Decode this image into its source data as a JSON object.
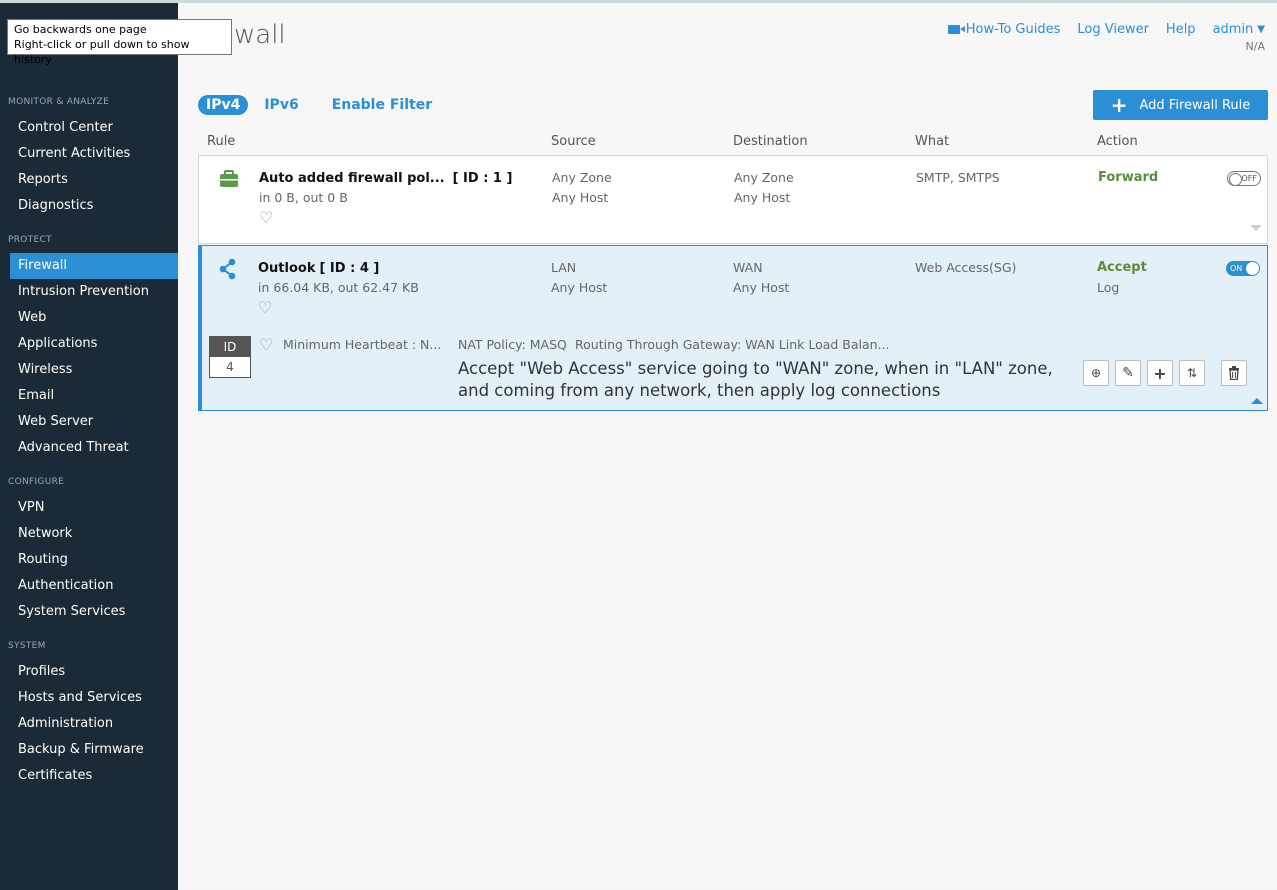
{
  "tooltip": {
    "line1": "Go backwards one page",
    "line2": "Right-click or pull down to show history"
  },
  "sidebar": {
    "sections": [
      {
        "title": "MONITOR & ANALYZE",
        "items": [
          "Control Center",
          "Current Activities",
          "Reports",
          "Diagnostics"
        ]
      },
      {
        "title": "PROTECT",
        "items": [
          "Firewall",
          "Intrusion Prevention",
          "Web",
          "Applications",
          "Wireless",
          "Email",
          "Web Server",
          "Advanced Threat"
        ]
      },
      {
        "title": "CONFIGURE",
        "items": [
          "VPN",
          "Network",
          "Routing",
          "Authentication",
          "System Services"
        ]
      },
      {
        "title": "SYSTEM",
        "items": [
          "Profiles",
          "Hosts and Services",
          "Administration",
          "Backup & Firmware",
          "Certificates"
        ]
      }
    ],
    "active": "Firewall"
  },
  "header": {
    "title": "ewall",
    "links": {
      "howto": "How-To Guides",
      "logviewer": "Log Viewer",
      "help": "Help",
      "admin": "admin"
    },
    "na": "N/A"
  },
  "tabs": {
    "ipv4": "IPv4",
    "ipv6": "IPv6",
    "filter": "Enable Filter"
  },
  "add_button": "Add Firewall Rule",
  "columns": {
    "rule": "Rule",
    "source": "Source",
    "destination": "Destination",
    "what": "What",
    "action": "Action"
  },
  "rules": [
    {
      "name": "Auto added firewall pol...",
      "id_label": "[ ID : 1 ]",
      "traffic": "in 0 B, out 0 B",
      "source1": "Any Zone",
      "source2": "Any Host",
      "dest1": "Any Zone",
      "dest2": "Any Host",
      "what": "SMTP, SMTPS",
      "action": "Forward",
      "toggle": "OFF"
    },
    {
      "name": "Outlook",
      "id_label": "[ ID : 4 ]",
      "traffic": "in 66.04 KB, out 62.47 KB",
      "source1": "LAN",
      "source2": "Any Host",
      "dest1": "WAN",
      "dest2": "Any Host",
      "what": "Web Access(SG)",
      "action": "Accept",
      "action2": "Log",
      "toggle": "ON",
      "id_box_label": "ID",
      "id_box_value": "4",
      "heartbeat": "Minimum Heartbeat : N...",
      "nat": "NAT Policy: MASQ",
      "routing": "Routing Through Gateway: WAN Link Load Balan...",
      "description": "Accept \"Web Access\" service going to \"WAN\" zone, when in \"LAN\" zone, and coming from any network, then apply log connections"
    }
  ]
}
